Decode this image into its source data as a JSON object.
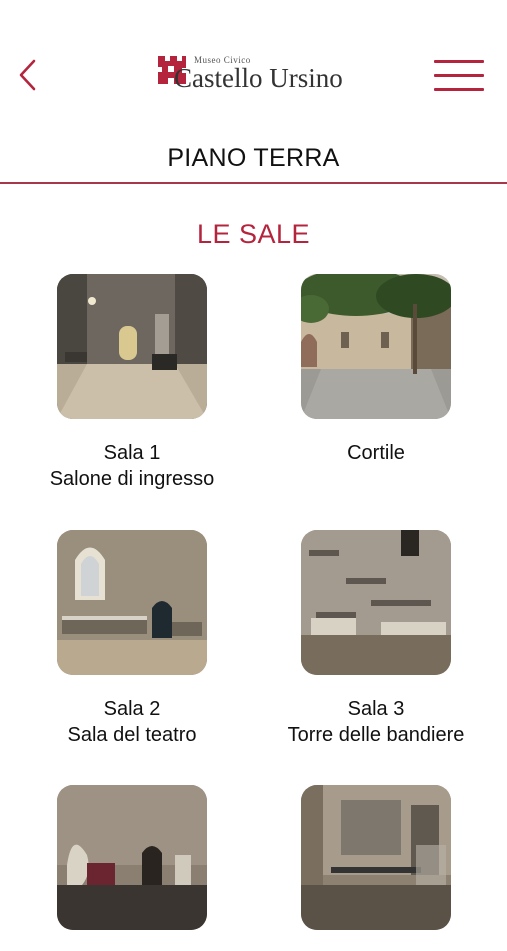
{
  "header": {
    "logo_small": "Museo Civico",
    "logo_big": "Castello Ursino"
  },
  "page": {
    "floor_title": "PIANO TERRA",
    "section_title": "LE SALE"
  },
  "rooms": [
    {
      "line1": "Sala 1",
      "line2": "Salone di ingresso"
    },
    {
      "line1": "Cortile",
      "line2": ""
    },
    {
      "line1": "Sala 2",
      "line2": "Sala del teatro"
    },
    {
      "line1": "Sala 3",
      "line2": "Torre delle bandiere"
    },
    {
      "line1": "",
      "line2": ""
    },
    {
      "line1": "",
      "line2": ""
    }
  ],
  "colors": {
    "accent": "#b5243d",
    "divider": "#a8374b"
  }
}
